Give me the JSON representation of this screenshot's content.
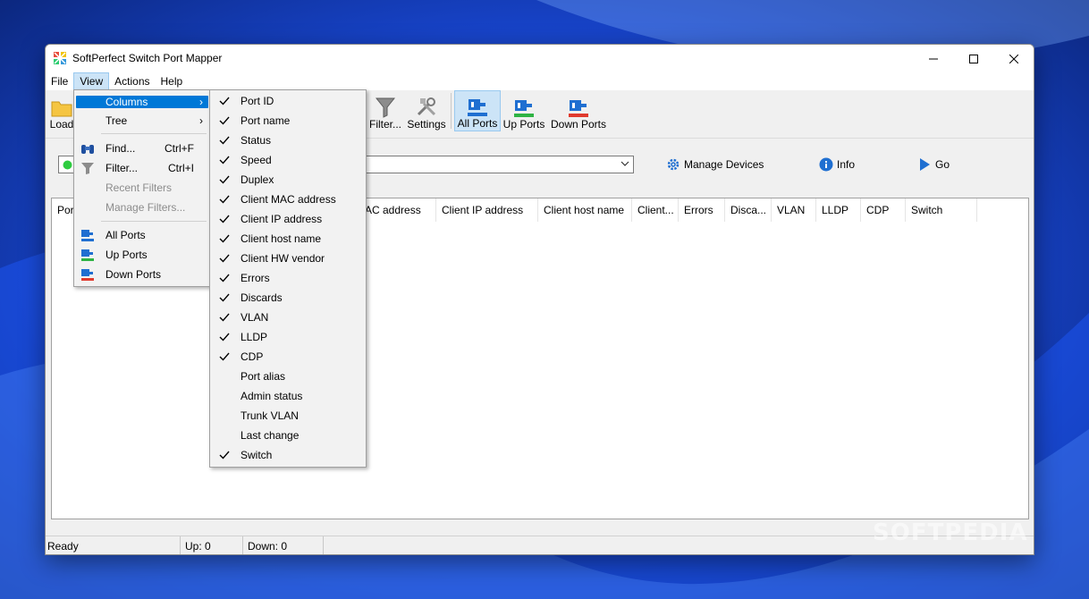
{
  "window": {
    "title": "SoftPerfect Switch Port Mapper"
  },
  "menubar": {
    "file": "File",
    "view": "View",
    "actions": "Actions",
    "help": "Help"
  },
  "toolbar": {
    "load": "Load",
    "filter": "Filter...",
    "settings": "Settings",
    "all_ports": "All Ports",
    "up_ports": "Up Ports",
    "down_ports": "Down Ports"
  },
  "addressbar": {
    "manage_devices": "Manage Devices",
    "info": "Info",
    "go": "Go"
  },
  "grid": {
    "columns": [
      "Por",
      "AC address",
      "Client IP address",
      "Client host name",
      "Client...",
      "Errors",
      "Disca...",
      "VLAN",
      "LLDP",
      "CDP",
      "Switch"
    ]
  },
  "statusbar": {
    "status": "Ready",
    "up": "Up: 0",
    "down": "Down: 0"
  },
  "view_menu": {
    "columns": "Columns",
    "tree": "Tree",
    "find": "Find...",
    "find_shortcut": "Ctrl+F",
    "filter": "Filter...",
    "filter_shortcut": "Ctrl+I",
    "recent_filters": "Recent Filters",
    "manage_filters": "Manage Filters...",
    "all_ports": "All Ports",
    "up_ports": "Up Ports",
    "down_ports": "Down Ports"
  },
  "columns_submenu": [
    {
      "label": "Port ID",
      "checked": true
    },
    {
      "label": "Port name",
      "checked": true
    },
    {
      "label": "Status",
      "checked": true
    },
    {
      "label": "Speed",
      "checked": true
    },
    {
      "label": "Duplex",
      "checked": true
    },
    {
      "label": "Client MAC address",
      "checked": true
    },
    {
      "label": "Client IP address",
      "checked": true
    },
    {
      "label": "Client host name",
      "checked": true
    },
    {
      "label": "Client HW vendor",
      "checked": true
    },
    {
      "label": "Errors",
      "checked": true
    },
    {
      "label": "Discards",
      "checked": true
    },
    {
      "label": "VLAN",
      "checked": true
    },
    {
      "label": "LLDP",
      "checked": true
    },
    {
      "label": "CDP",
      "checked": true
    },
    {
      "label": "Port alias",
      "checked": false
    },
    {
      "label": "Admin status",
      "checked": false
    },
    {
      "label": "Trunk VLAN",
      "checked": false
    },
    {
      "label": "Last change",
      "checked": false
    },
    {
      "label": "Switch",
      "checked": true
    }
  ],
  "watermark": "SOFTPEDIA",
  "colors": {
    "accent": "#0078d7",
    "pressed": "#cce4f7",
    "status_online": "#2ecc40"
  }
}
